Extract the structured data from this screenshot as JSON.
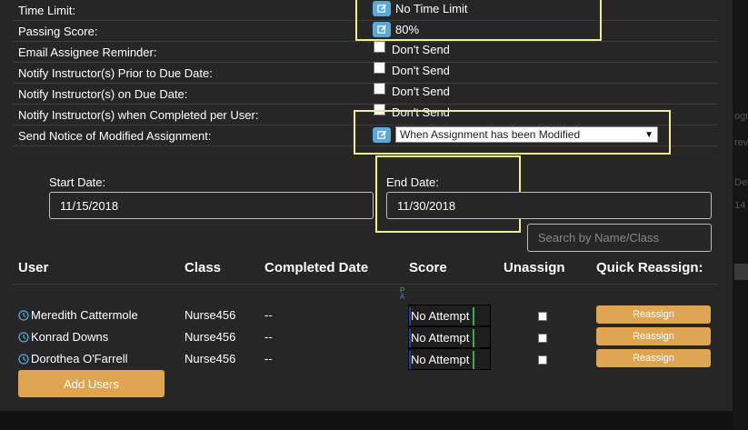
{
  "settings": [
    {
      "label": "Time Limit:",
      "value": "No Time Limit",
      "control": "edit"
    },
    {
      "label": "Passing Score:",
      "value": "80%",
      "control": "edit"
    },
    {
      "label": "Email Assignee Reminder:",
      "value": "Don't Send",
      "control": "checkbox"
    },
    {
      "label": "Notify Instructor(s) Prior to Due Date:",
      "value": "Don't Send",
      "control": "checkbox"
    },
    {
      "label": "Notify Instructor(s) on Due Date:",
      "value": "Don't Send",
      "control": "checkbox"
    },
    {
      "label": "Notify Instructor(s) when Completed per User:",
      "value": "Don't Send",
      "control": "checkbox"
    },
    {
      "label": "Send Notice of Modified Assignment:",
      "value": "When Assignment has been Modified",
      "control": "select"
    }
  ],
  "dates": {
    "start_label": "Start Date:",
    "start_value": "11/15/2018",
    "end_label": "End Date:",
    "end_value": "11/30/2018"
  },
  "search": {
    "placeholder": "Search by Name/Class"
  },
  "table": {
    "headers": {
      "user": "User",
      "class": "Class",
      "completed": "Completed Date",
      "score": "Score",
      "unassign": "Unassign",
      "quick_reassign": "Quick Reassign:"
    },
    "score_marker_top": "P",
    "score_marker_bottom": "A",
    "rows": [
      {
        "user": "Meredith Cattermole",
        "class": "Nurse456",
        "completed": "--",
        "score": "No Attempt",
        "action": "Reassign"
      },
      {
        "user": "Konrad Downs",
        "class": "Nurse456",
        "completed": "--",
        "score": "No Attempt",
        "action": "Reassign"
      },
      {
        "user": "Dorothea O'Farrell",
        "class": "Nurse456",
        "completed": "--",
        "score": "No Attempt",
        "action": "Reassign"
      }
    ]
  },
  "add_users_label": "Add Users",
  "background_fragments": [
    "ogra",
    "revie",
    "Dece",
    "14"
  ],
  "colors": {
    "edit_icon_bg": "#5aa9d6",
    "accent_button": "#e0a553",
    "highlight_box": "#eef08a",
    "panel_bg": "#262626"
  }
}
